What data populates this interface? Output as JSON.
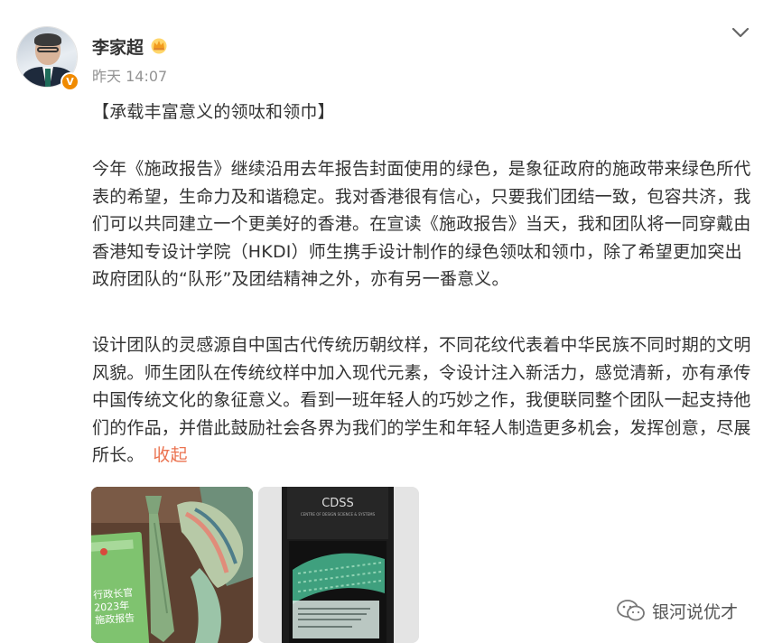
{
  "author": {
    "name": "李家超",
    "badge": "V",
    "time": "昨天 14:07"
  },
  "post": {
    "title": "【承载丰富意义的领呔和领巾】",
    "paragraph1": "今年《施政报告》继续沿用去年报告封面使用的绿色，是象征政府的施政带来绿色所代表的希望，生命力及和谐稳定。我对香港很有信心，只要我们团结一致，包容共济，我们可以共同建立一个更美好的香港。在宣读《施政报告》当天，我和团队将一同穿戴由香港知专设计学院（HKDI）师生携手设计制作的绿色领呔和领巾，除了希望更加突出政府团队的“队形”及团结精神之外，亦有另一番意义。",
    "paragraph2": "设计团队的灵感源自中国古代传统历朝纹样，不同花纹代表着中华民族不同时期的文明风貌。师生团队在传统纹样中加入现代元素，令设计注入新活力，感觉清新，亦有承传中国传统文化的象征意义。看到一班年轻人的巧妙之作，我便联同整个团队一起支持他们的作品，并借此鼓励社会各界为我们的学生和年轻人制造更多机会，发挥创意，尽展所长。",
    "collapse_label": "收起"
  },
  "photos": {
    "book_line1": "行政长官",
    "book_line2": "2023年",
    "book_line3": "施政报告",
    "box_brand": "CDSS",
    "box_sub": "CENTRE OF DESIGN SCIENCE & SYSTEMS"
  },
  "watermark": {
    "text": "银河说优才"
  },
  "colors": {
    "link": "#eb7350",
    "time": "#939393",
    "badge": "#f08a00"
  }
}
